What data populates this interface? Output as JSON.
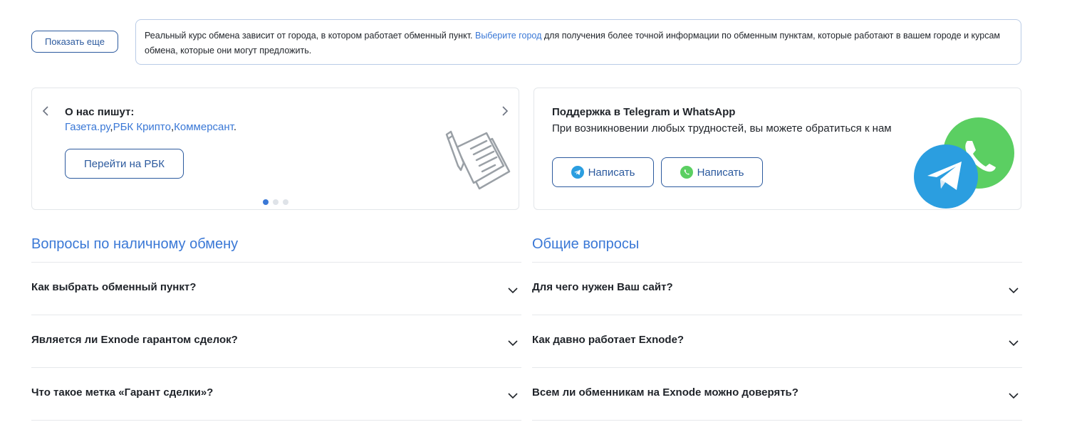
{
  "show_more": {
    "label": "Показать еще"
  },
  "info_box": {
    "text_before": "Реальный курс обмена зависит от города, в котором работает обменный пункт. ",
    "link": "Выберите город",
    "text_after": " для получения более точной информации по обменным пунктам, которые работают в вашем городе и курсам обмена, которые они могут предложить."
  },
  "press_card": {
    "title": "О нас пишут:",
    "links": [
      "Газета.ру",
      "РБК Крипто",
      "Коммерсант"
    ],
    "separator": ",",
    "end": ".",
    "button_label": "Перейти на РБК",
    "dots_total": 3,
    "dots_active": 0,
    "illustration": "document-pen-icon"
  },
  "support_card": {
    "title": "Поддержка в Telegram и WhatsApp",
    "text": "При возникновении любых трудностей, вы можете обратиться к нам",
    "telegram_button": {
      "label": "Написать",
      "icon": "telegram-icon"
    },
    "whatsapp_button": {
      "label": "Написать",
      "icon": "whatsapp-icon"
    },
    "colors": {
      "telegram": "#2b9ee0",
      "whatsapp": "#5bcf62"
    }
  },
  "faq_cash": {
    "heading": "Вопросы по наличному обмену",
    "items": [
      "Как выбрать обменный пункт?",
      "Является ли Exnode гарантом сделок?",
      "Что такое метка «Гарант сделки»?"
    ]
  },
  "faq_general": {
    "heading": "Общие вопросы",
    "items": [
      "Для чего нужен Ваш сайт?",
      "Как давно работает Exnode?",
      "Всем ли обменникам на Exnode можно доверять?"
    ]
  },
  "colors": {
    "accent": "#3a78d6",
    "button_border": "#2c5a9e",
    "text": "#1f2329",
    "divider": "#e6e8eb"
  }
}
